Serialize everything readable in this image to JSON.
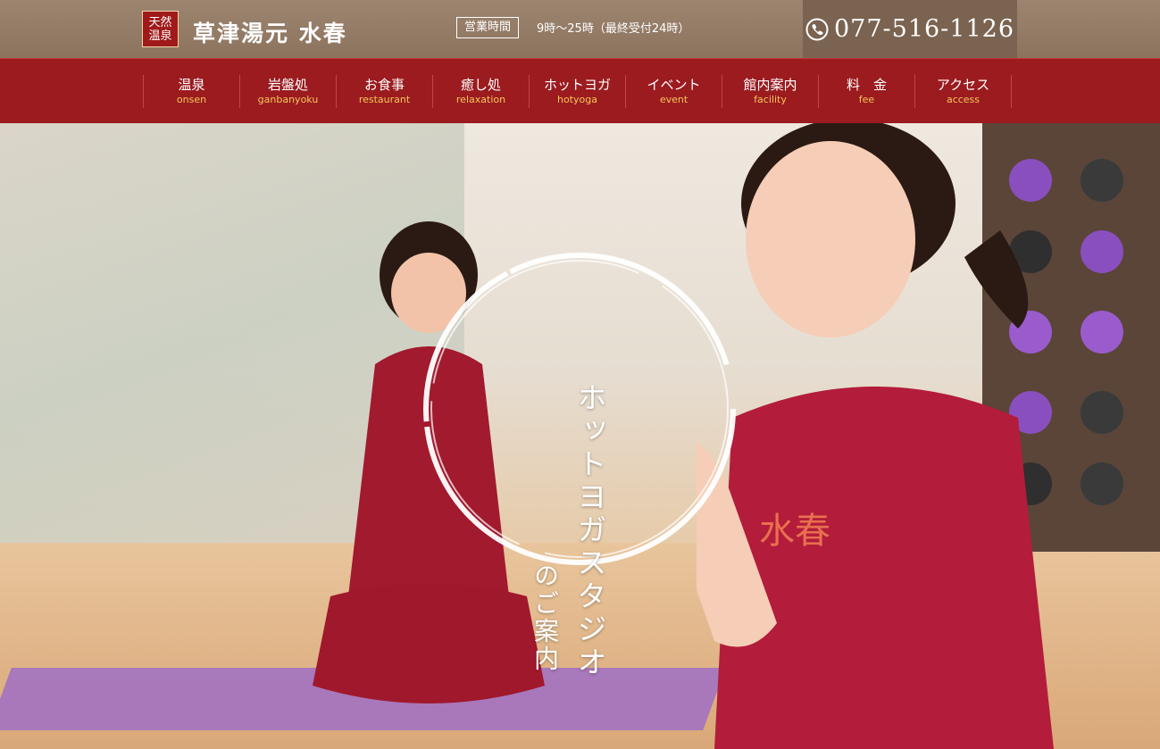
{
  "header": {
    "badge_text": "天然\n温泉",
    "site_name": "草津湯元 水春",
    "hours_label": "営業時間",
    "hours_value": "9時～25時（最終受付24時）",
    "phone": "077-516-1126"
  },
  "nav": {
    "items": [
      {
        "jp": "温泉",
        "en": "onsen"
      },
      {
        "jp": "岩盤処",
        "en": "ganbanyoku"
      },
      {
        "jp": "お食事",
        "en": "restaurant"
      },
      {
        "jp": "癒し処",
        "en": "relaxation"
      },
      {
        "jp": "ホットヨガ",
        "en": "hotyoga"
      },
      {
        "jp": "イベント",
        "en": "event"
      },
      {
        "jp": "館内案内",
        "en": "facility"
      },
      {
        "jp": "料　金",
        "en": "fee"
      },
      {
        "jp": "アクセス",
        "en": "access"
      }
    ]
  },
  "hero": {
    "title": "ホットヨガスタジオ",
    "subtitle": "のご案内"
  },
  "colors": {
    "header_bg": "#8c735e",
    "nav_bg": "#9b1b1f",
    "nav_en": "#f4c75a",
    "badge_bg": "#a01a1a"
  },
  "icons": {
    "phone": "phone-icon"
  }
}
